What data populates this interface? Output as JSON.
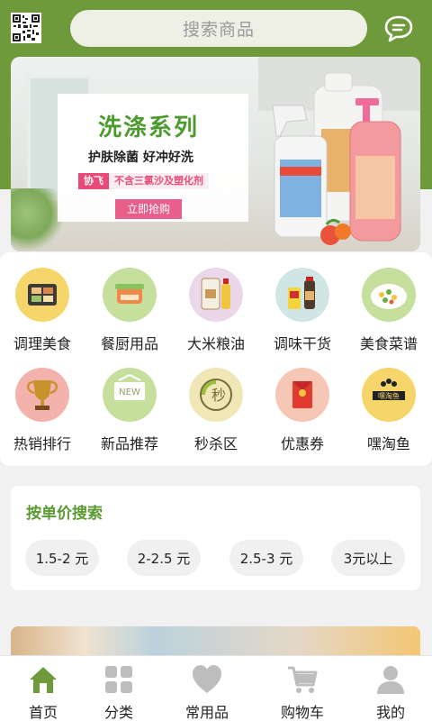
{
  "header": {
    "search_placeholder": "搜索商品",
    "qr_icon": "qr-code-icon",
    "message_icon": "chat-bubble-icon"
  },
  "banner": {
    "title": "洗涤系列",
    "subtitle": "护肤除菌  好冲好洗",
    "brand": "协飞",
    "tagline": "不含三氯沙及塑化剂",
    "cta": "立即抢购"
  },
  "categories": [
    {
      "label": "调理美食",
      "icon": "prepared-food-icon",
      "bg": "#f6d66b"
    },
    {
      "label": "餐厨用品",
      "icon": "kitchenware-icon",
      "bg": "#c6df9c"
    },
    {
      "label": "大米粮油",
      "icon": "rice-oil-icon",
      "bg": "#ead8ea"
    },
    {
      "label": "调味干货",
      "icon": "seasoning-icon",
      "bg": "#cfe6e4"
    },
    {
      "label": "美食菜谱",
      "icon": "recipe-icon",
      "bg": "#c6df9c"
    },
    {
      "label": "热销排行",
      "icon": "trophy-icon",
      "bg": "#f4b2ad"
    },
    {
      "label": "新品推荐",
      "icon": "new-sign-icon",
      "bg": "#c6df9c"
    },
    {
      "label": "秒杀区",
      "icon": "flash-sale-icon",
      "bg": "#efe7b6"
    },
    {
      "label": "优惠券",
      "icon": "red-envelope-icon",
      "bg": "#f6c7b4"
    },
    {
      "label": "嘿淘鱼",
      "icon": "heitaoyu-logo-icon",
      "bg": "#f6d66b"
    }
  ],
  "price_search": {
    "title": "按单价搜索",
    "options": [
      "1.5-2 元",
      "2-2.5 元",
      "2.5-3 元",
      "3元以上"
    ]
  },
  "tabbar": {
    "active_color": "#6e9a3c",
    "inactive_color": "#bdbdbd",
    "tabs": [
      {
        "label": "首页",
        "icon": "home-icon"
      },
      {
        "label": "分类",
        "icon": "grid-icon"
      },
      {
        "label": "常用品",
        "icon": "heart-icon"
      },
      {
        "label": "购物车",
        "icon": "cart-icon"
      },
      {
        "label": "我的",
        "icon": "person-icon"
      }
    ]
  }
}
